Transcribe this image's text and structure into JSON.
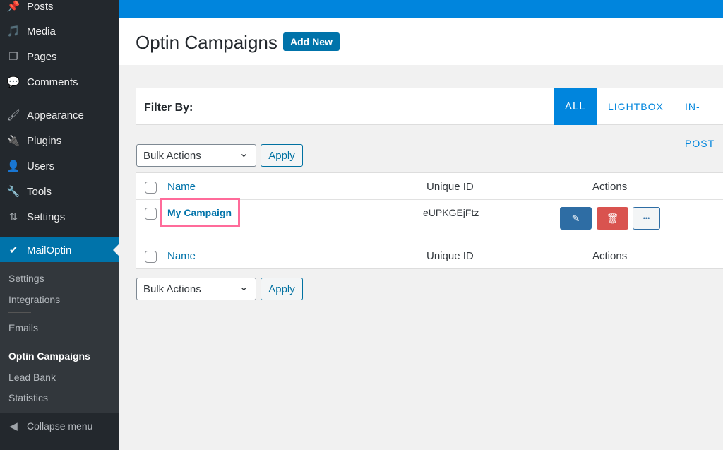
{
  "sidebar": {
    "items": [
      {
        "label": "Posts",
        "icon": "pin-icon",
        "glyph": "📌"
      },
      {
        "label": "Media",
        "icon": "media-icon",
        "glyph": "🎵"
      },
      {
        "label": "Pages",
        "icon": "pages-icon",
        "glyph": "❐"
      },
      {
        "label": "Comments",
        "icon": "comment-icon",
        "glyph": "💬"
      },
      {
        "label": "Appearance",
        "icon": "brush-icon",
        "glyph": "🖌"
      },
      {
        "label": "Plugins",
        "icon": "plug-icon",
        "glyph": "🔌"
      },
      {
        "label": "Users",
        "icon": "user-icon",
        "glyph": "👤"
      },
      {
        "label": "Tools",
        "icon": "wrench-icon",
        "glyph": "🔧"
      },
      {
        "label": "Settings",
        "icon": "settings-icon",
        "glyph": "⇅"
      }
    ],
    "active": {
      "label": "MailOptin",
      "icon": "check-icon",
      "glyph": "✔"
    },
    "submenu": [
      "Settings",
      "Integrations",
      "Emails",
      "Optin Campaigns",
      "Lead Bank",
      "Statistics"
    ],
    "collapse": {
      "label": "Collapse menu",
      "glyph": "◀"
    }
  },
  "header": {
    "title": "Optin Campaigns",
    "add_new": "Add New"
  },
  "filter": {
    "label": "Filter By:",
    "tabs": [
      "ALL",
      "LIGHTBOX",
      "IN-POST"
    ]
  },
  "bulk": {
    "selected": "Bulk Actions",
    "apply": "Apply"
  },
  "table": {
    "columns": [
      "Name",
      "Unique ID",
      "Actions"
    ],
    "rows": [
      {
        "name": "My Campaign",
        "unique_id": "eUPKGEjFtz"
      }
    ],
    "actions": {
      "edit": "✎",
      "delete": "🗑",
      "more": "•••"
    }
  },
  "colors": {
    "accent": "#0073aa",
    "highlight": "#ff6b9a",
    "danger": "#d9534f",
    "edit": "#2e6da4"
  }
}
